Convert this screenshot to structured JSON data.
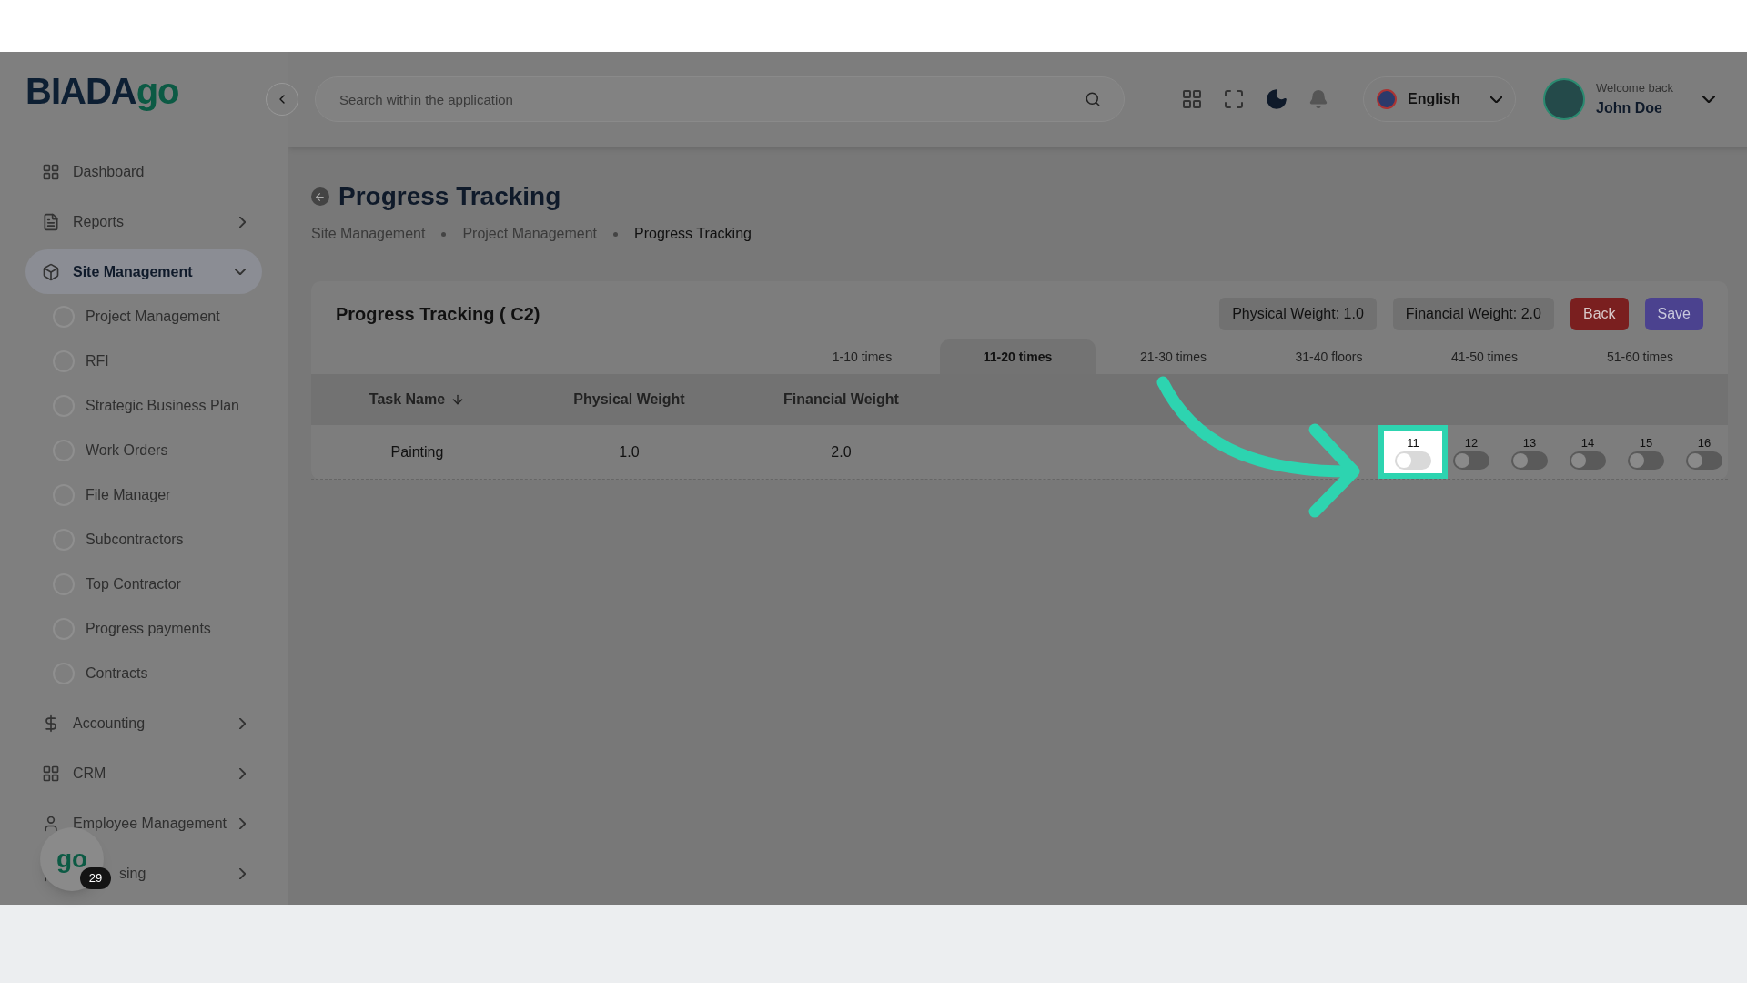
{
  "logo": {
    "text": "BIADA",
    "accent": "go"
  },
  "search": {
    "placeholder": "Search within the application"
  },
  "language": {
    "label": "English"
  },
  "user": {
    "greeting": "Welcome back",
    "name": "John Doe"
  },
  "sidebar": {
    "items": [
      {
        "label": "Dashboard",
        "kind": "leaf",
        "selected": false
      },
      {
        "label": "Reports",
        "kind": "group",
        "expanded": false,
        "selected": false
      },
      {
        "label": "Site Management",
        "kind": "group",
        "expanded": true,
        "selected": true,
        "children": [
          {
            "label": "Project Management"
          },
          {
            "label": "RFI"
          },
          {
            "label": "Strategic Business Plan"
          },
          {
            "label": "Work Orders"
          },
          {
            "label": "File Manager"
          },
          {
            "label": "Subcontractors"
          },
          {
            "label": "Top Contractor"
          },
          {
            "label": "Progress payments"
          },
          {
            "label": "Contracts"
          }
        ]
      },
      {
        "label": "Accounting",
        "kind": "group",
        "expanded": false,
        "selected": false
      },
      {
        "label": "CRM",
        "kind": "group",
        "expanded": false,
        "selected": false
      },
      {
        "label": "Employee Management",
        "kind": "group",
        "expanded": false,
        "selected": false
      },
      {
        "label": "sing",
        "kind": "group_covered",
        "expanded": false,
        "selected": false
      }
    ]
  },
  "floating_badge": {
    "count": "29",
    "logo": "go"
  },
  "page": {
    "title": "Progress Tracking",
    "breadcrumbs": [
      "Site Management",
      "Project Management",
      "Progress Tracking"
    ]
  },
  "card": {
    "title": "Progress Tracking ( C2)",
    "chips": [
      "Physical Weight: 1.0",
      "Financial Weight: 2.0"
    ],
    "buttons": [
      {
        "label": "Back",
        "kind": "danger"
      },
      {
        "label": "Save",
        "kind": "primary"
      }
    ],
    "tabs": [
      {
        "label": "1-10 times",
        "selected": false
      },
      {
        "label": "11-20 times",
        "selected": true
      },
      {
        "label": "21-30 times",
        "selected": false
      },
      {
        "label": "31-40 floors",
        "selected": false
      },
      {
        "label": "41-50 times",
        "selected": false
      },
      {
        "label": "51-60 times",
        "selected": false
      }
    ],
    "columns": [
      "Task Name",
      "Physical Weight",
      "Financial Weight"
    ],
    "rows": [
      {
        "cells": [
          "Painting",
          "1.0",
          "2.0"
        ],
        "toggles": [
          {
            "label": "11",
            "on": false,
            "highlighted": true
          },
          {
            "label": "12",
            "on": false,
            "highlighted": false
          },
          {
            "label": "13",
            "on": false,
            "highlighted": false
          },
          {
            "label": "14",
            "on": false,
            "highlighted": false
          },
          {
            "label": "15",
            "on": false,
            "highlighted": false
          },
          {
            "label": "16",
            "on": false,
            "highlighted": false
          }
        ]
      }
    ]
  }
}
